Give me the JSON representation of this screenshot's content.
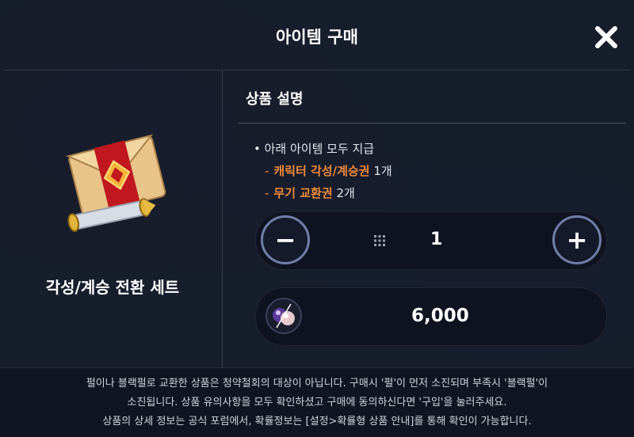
{
  "header": {
    "title": "아이템 구매"
  },
  "item": {
    "name": "각성/계승 전환 세트"
  },
  "description": {
    "section_title": "상품 설명",
    "bullet": "• 아래 아이템 모두 지급",
    "lines": [
      {
        "name": "캐릭터 각성/계승권",
        "count": "1개"
      },
      {
        "name": "무기 교환권",
        "count": "2개"
      }
    ]
  },
  "quantity": {
    "value": "1",
    "minus_symbol": "−",
    "plus_symbol": "+"
  },
  "price": {
    "value": "6,000",
    "currency_icon": "pearl-currency-icon"
  },
  "notice": [
    "펄이나 블랙펄로 교환한 상품은 청약철회의 대상이 아닙니다. 구매시 '펄'이 먼저 소진되며 부족시 '블랙펄'이",
    "소진됩니다. 상품 유의사항을 모두 확인하셨고 구매에 동의하신다면 '구입'을 눌러주세요.",
    "상품의 상세 정보는 공식 포럼에서, 확률정보는 [설정>확률형 상품 안내]를 통해 확인이 가능합니다."
  ],
  "colors": {
    "accent": "#f08a3c",
    "button_ring": "#6e7fa8",
    "panel": "#0f1320"
  }
}
